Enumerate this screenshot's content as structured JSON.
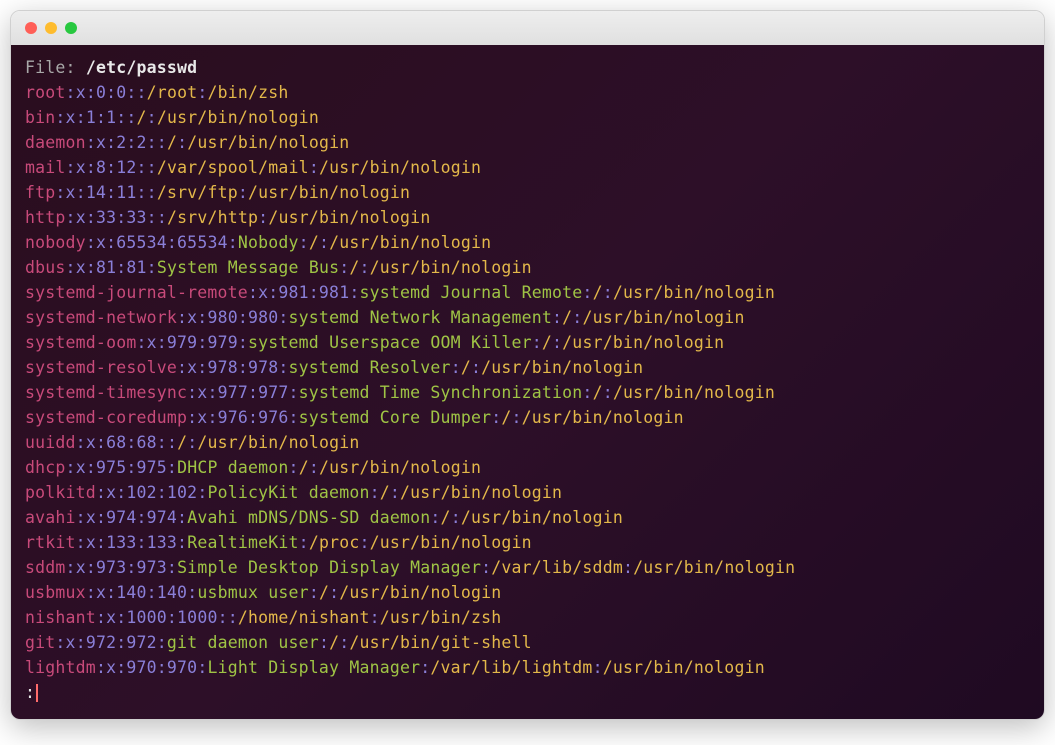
{
  "file_label": "File: ",
  "file_path": "/etc/passwd",
  "entries": [
    {
      "user": "root",
      "x": "x",
      "uid": "0",
      "gid": "0",
      "desc": "",
      "home": "/root",
      "shell": "/bin/zsh"
    },
    {
      "user": "bin",
      "x": "x",
      "uid": "1",
      "gid": "1",
      "desc": "",
      "home": "/",
      "shell": "/usr/bin/nologin"
    },
    {
      "user": "daemon",
      "x": "x",
      "uid": "2",
      "gid": "2",
      "desc": "",
      "home": "/",
      "shell": "/usr/bin/nologin"
    },
    {
      "user": "mail",
      "x": "x",
      "uid": "8",
      "gid": "12",
      "desc": "",
      "home": "/var/spool/mail",
      "shell": "/usr/bin/nologin"
    },
    {
      "user": "ftp",
      "x": "x",
      "uid": "14",
      "gid": "11",
      "desc": "",
      "home": "/srv/ftp",
      "shell": "/usr/bin/nologin"
    },
    {
      "user": "http",
      "x": "x",
      "uid": "33",
      "gid": "33",
      "desc": "",
      "home": "/srv/http",
      "shell": "/usr/bin/nologin"
    },
    {
      "user": "nobody",
      "x": "x",
      "uid": "65534",
      "gid": "65534",
      "desc": "Nobody",
      "home": "/",
      "shell": "/usr/bin/nologin"
    },
    {
      "user": "dbus",
      "x": "x",
      "uid": "81",
      "gid": "81",
      "desc": "System Message Bus",
      "home": "/",
      "shell": "/usr/bin/nologin"
    },
    {
      "user": "systemd-journal-remote",
      "x": "x",
      "uid": "981",
      "gid": "981",
      "desc": "systemd Journal Remote",
      "home": "/",
      "shell": "/usr/bin/nologin"
    },
    {
      "user": "systemd-network",
      "x": "x",
      "uid": "980",
      "gid": "980",
      "desc": "systemd Network Management",
      "home": "/",
      "shell": "/usr/bin/nologin"
    },
    {
      "user": "systemd-oom",
      "x": "x",
      "uid": "979",
      "gid": "979",
      "desc": "systemd Userspace OOM Killer",
      "home": "/",
      "shell": "/usr/bin/nologin"
    },
    {
      "user": "systemd-resolve",
      "x": "x",
      "uid": "978",
      "gid": "978",
      "desc": "systemd Resolver",
      "home": "/",
      "shell": "/usr/bin/nologin"
    },
    {
      "user": "systemd-timesync",
      "x": "x",
      "uid": "977",
      "gid": "977",
      "desc": "systemd Time Synchronization",
      "home": "/",
      "shell": "/usr/bin/nologin"
    },
    {
      "user": "systemd-coredump",
      "x": "x",
      "uid": "976",
      "gid": "976",
      "desc": "systemd Core Dumper",
      "home": "/",
      "shell": "/usr/bin/nologin"
    },
    {
      "user": "uuidd",
      "x": "x",
      "uid": "68",
      "gid": "68",
      "desc": "",
      "home": "/",
      "shell": "/usr/bin/nologin"
    },
    {
      "user": "dhcp",
      "x": "x",
      "uid": "975",
      "gid": "975",
      "desc": "DHCP daemon",
      "home": "/",
      "shell": "/usr/bin/nologin"
    },
    {
      "user": "polkitd",
      "x": "x",
      "uid": "102",
      "gid": "102",
      "desc": "PolicyKit daemon",
      "home": "/",
      "shell": "/usr/bin/nologin"
    },
    {
      "user": "avahi",
      "x": "x",
      "uid": "974",
      "gid": "974",
      "desc": "Avahi mDNS/DNS-SD daemon",
      "home": "/",
      "shell": "/usr/bin/nologin"
    },
    {
      "user": "rtkit",
      "x": "x",
      "uid": "133",
      "gid": "133",
      "desc": "RealtimeKit",
      "home": "/proc",
      "shell": "/usr/bin/nologin"
    },
    {
      "user": "sddm",
      "x": "x",
      "uid": "973",
      "gid": "973",
      "desc": "Simple Desktop Display Manager",
      "home": "/var/lib/sddm",
      "shell": "/usr/bin/nologin"
    },
    {
      "user": "usbmux",
      "x": "x",
      "uid": "140",
      "gid": "140",
      "desc": "usbmux user",
      "home": "/",
      "shell": "/usr/bin/nologin"
    },
    {
      "user": "nishant",
      "x": "x",
      "uid": "1000",
      "gid": "1000",
      "desc": "",
      "home": "/home/nishant",
      "shell": "/usr/bin/zsh"
    },
    {
      "user": "git",
      "x": "x",
      "uid": "972",
      "gid": "972",
      "desc": "git daemon user",
      "home": "/",
      "shell": "/usr/bin/git-shell"
    },
    {
      "user": "lightdm",
      "x": "x",
      "uid": "970",
      "gid": "970",
      "desc": "Light Display Manager",
      "home": "/var/lib/lightdm",
      "shell": "/usr/bin/nologin"
    }
  ],
  "prompt": ":"
}
